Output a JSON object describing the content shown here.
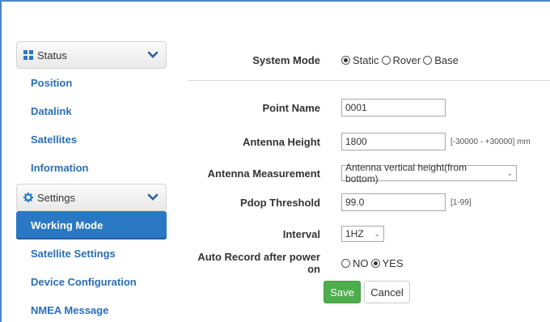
{
  "sidebar": {
    "status_group": {
      "label": "Status",
      "icon": "grid-icon"
    },
    "status_items": [
      "Position",
      "Datalink",
      "Satellites",
      "Information"
    ],
    "settings_group": {
      "label": "Settings",
      "icon": "gear-icon"
    },
    "settings_items": [
      "Working Mode",
      "Satellite Settings",
      "Device Configuration",
      "NMEA Message"
    ],
    "active_item": "Working Mode"
  },
  "form": {
    "system_mode": {
      "label": "System Mode",
      "options": [
        "Static",
        "Rover",
        "Base"
      ],
      "selected": "Static"
    },
    "point_name": {
      "label": "Point Name",
      "value": "0001"
    },
    "antenna_height": {
      "label": "Antenna Height",
      "value": "1800",
      "hint": "[-30000 - +30000] mm"
    },
    "antenna_measurement": {
      "label": "Antenna Measurement",
      "value": "Antenna vertical height(from bottom)"
    },
    "pdop_threshold": {
      "label": "Pdop Threshold",
      "value": "99.0",
      "hint": "[1-99]"
    },
    "interval": {
      "label": "Interval",
      "value": "1HZ"
    },
    "auto_record": {
      "label": "Auto Record after power on",
      "options": [
        "NO",
        "YES"
      ],
      "selected": "YES"
    }
  },
  "buttons": {
    "save": "Save",
    "cancel": "Cancel"
  },
  "colors": {
    "accent": "#2a78c4",
    "link": "#2a6fb5",
    "save": "#4cae4c",
    "frame": "#4a86c8"
  }
}
